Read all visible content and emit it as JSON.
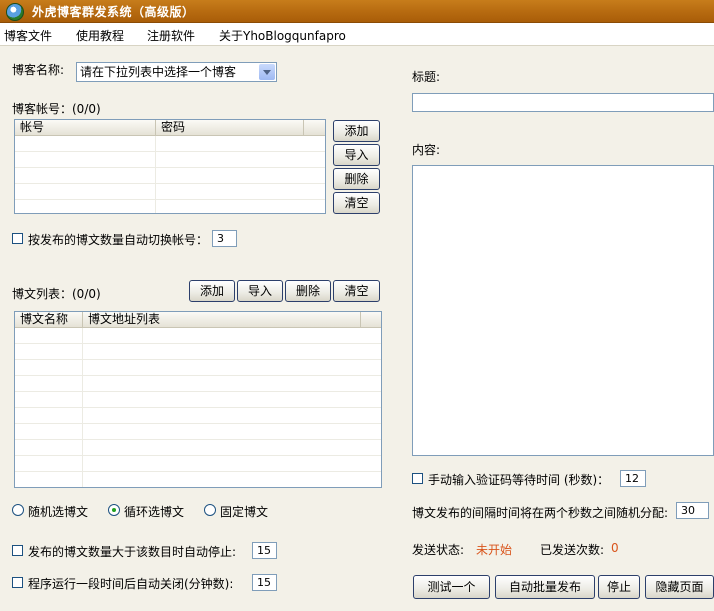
{
  "window": {
    "title": "外虎博客群发系统（高级版）"
  },
  "menu": [
    "博客文件",
    "使用教程",
    "注册软件",
    "关于YhoBlogqunfapro"
  ],
  "blog_name": {
    "label": "博客名称:",
    "selected": "请在下拉列表中选择一个博客"
  },
  "accounts": {
    "label": "博客帐号：(0/0)",
    "columns": [
      "帐号",
      "密码"
    ],
    "buttons": {
      "add": "添加",
      "import": "导入",
      "delete": "删除",
      "clear": "清空"
    },
    "auto_switch": {
      "label": "按发布的博文数量自动切换帐号：",
      "value": "3"
    }
  },
  "posts": {
    "label": "博文列表：(0/0)",
    "columns": [
      "博文名称",
      "博文地址列表"
    ],
    "buttons": {
      "add": "添加",
      "import": "导入",
      "delete": "删除",
      "clear": "清空"
    }
  },
  "selection_mode": {
    "random": "随机选博文",
    "loop": "循环选博文",
    "fixed": "固定博文",
    "selected": "loop"
  },
  "auto_stop": {
    "label": "发布的博文数量大于该数目时自动停止:",
    "value": "15"
  },
  "auto_close": {
    "label": "程序运行一段时间后自动关闭(分钟数):",
    "value": "15"
  },
  "editor": {
    "title_label": "标题:",
    "content_label": "内容:",
    "title_value": "",
    "content_value": ""
  },
  "captcha_wait": {
    "label": "手动输入验证码等待时间 (秒数)：",
    "value": "12"
  },
  "interval": {
    "label": "博文发布的间隔时间将在两个秒数之间随机分配:",
    "value": "30"
  },
  "status": {
    "label": "发送状态:",
    "value": "未开始",
    "count_label": "已发送次数:",
    "count_value": "0",
    "accent_color": "#d9541b"
  },
  "actions": {
    "test_one": "测试一个",
    "auto_batch": "自动批量发布",
    "stop": "停止",
    "hide_page": "隐藏页面"
  }
}
